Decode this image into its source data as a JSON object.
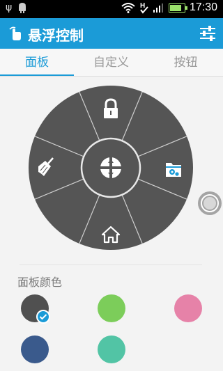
{
  "status_bar": {
    "time": "17:30",
    "left_icons": [
      "usb-icon",
      "android-debug-icon"
    ],
    "right_icons": [
      "wifi-icon",
      "network-h-icon",
      "signal-icon",
      "battery-icon"
    ],
    "battery_level": 0.8
  },
  "action_bar": {
    "title": "悬浮控制",
    "color": "#1b9bd7"
  },
  "tabs": [
    {
      "label": "面板",
      "active": true
    },
    {
      "label": "自定义",
      "active": false
    },
    {
      "label": "按钮",
      "active": false
    }
  ],
  "panel": {
    "segments": [
      "lock-icon",
      "",
      "folder-settings-icon",
      "",
      "home-icon",
      "",
      "broom-icon",
      ""
    ],
    "center": "navigation-icon",
    "color": "#555555"
  },
  "section": {
    "title": "面板颜色"
  },
  "colors": [
    {
      "name": "dark-gray",
      "hex": "#505050",
      "selected": true
    },
    {
      "name": "green",
      "hex": "#7ccd5a",
      "selected": false
    },
    {
      "name": "pink",
      "hex": "#e682a8",
      "selected": false
    },
    {
      "name": "navy",
      "hex": "#3a5a8c",
      "selected": false
    },
    {
      "name": "teal",
      "hex": "#52c4a5",
      "selected": false
    }
  ]
}
